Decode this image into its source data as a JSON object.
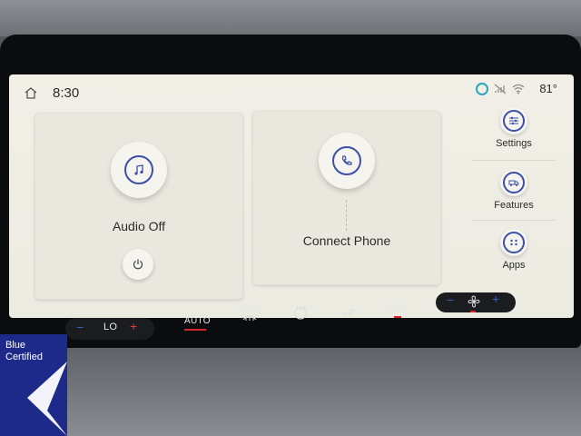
{
  "status_bar": {
    "time": "8:30",
    "temperature": "81°"
  },
  "tiles": {
    "audio": {
      "label": "Audio Off",
      "icon": "music-note-icon",
      "power_icon": "power-icon"
    },
    "phone": {
      "label": "Connect Phone",
      "icon": "phone-icon"
    }
  },
  "side_menu": [
    {
      "label": "Settings",
      "icon": "sliders-icon"
    },
    {
      "label": "Features",
      "icon": "truck-icon"
    },
    {
      "label": "Apps",
      "icon": "grid-icon"
    }
  ],
  "climate": {
    "temp_minus": "−",
    "temp_value": "LO",
    "temp_plus": "+",
    "auto": "AUTO",
    "max": "MAX",
    "ac": "A/C",
    "fan_minus": "−",
    "fan_plus": "+"
  },
  "badge": {
    "line1": "Blue",
    "line2": "Certified"
  },
  "colors": {
    "accent": "#3b4fa8",
    "screen_bg": "#ecebe2",
    "badge_bg": "#1e2a8a",
    "indicator_red": "#d8262c"
  }
}
